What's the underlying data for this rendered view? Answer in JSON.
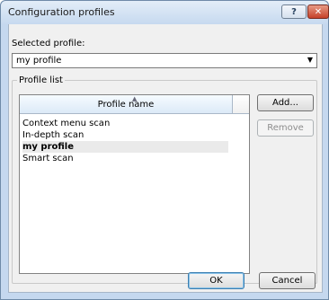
{
  "window": {
    "title": "Configuration profiles",
    "help_label": "?",
    "close_label": "✕"
  },
  "selected_profile": {
    "label": "Selected profile:",
    "value": "my profile"
  },
  "profile_list": {
    "group_label": "Profile list",
    "column_header": "Profile name",
    "rows": [
      {
        "label": "Context menu scan",
        "selected": false
      },
      {
        "label": "In-depth scan",
        "selected": false
      },
      {
        "label": "my profile",
        "selected": true
      },
      {
        "label": "Smart scan",
        "selected": false
      }
    ]
  },
  "buttons": {
    "add": "Add...",
    "remove": "Remove",
    "ok": "OK",
    "cancel": "Cancel"
  },
  "colors": {
    "titlebar": "#c6d9ef",
    "close_button": "#c6412a",
    "dialog_background": "#f0f0f0"
  }
}
